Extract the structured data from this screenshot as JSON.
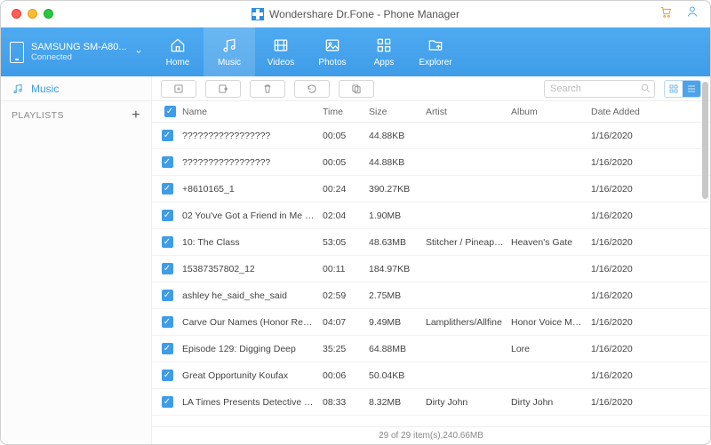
{
  "title": "Wondershare Dr.Fone - Phone Manager",
  "device": {
    "name": "SAMSUNG SM-A80...",
    "status": "Connected"
  },
  "nav": [
    {
      "key": "home",
      "label": "Home"
    },
    {
      "key": "music",
      "label": "Music"
    },
    {
      "key": "videos",
      "label": "Videos"
    },
    {
      "key": "photos",
      "label": "Photos"
    },
    {
      "key": "apps",
      "label": "Apps"
    },
    {
      "key": "explorer",
      "label": "Explorer"
    }
  ],
  "nav_active": "music",
  "sidebar": {
    "heading": "Music",
    "section": "PLAYLISTS"
  },
  "search_placeholder": "Search",
  "columns": {
    "name": "Name",
    "time": "Time",
    "size": "Size",
    "artist": "Artist",
    "album": "Album",
    "date": "Date Added"
  },
  "rows": [
    {
      "name": "?????????????????",
      "time": "00:05",
      "size": "44.88KB",
      "artist": "",
      "album": "",
      "date": "1/16/2020"
    },
    {
      "name": "?????????????????",
      "time": "00:05",
      "size": "44.88KB",
      "artist": "",
      "album": "",
      "date": "1/16/2020"
    },
    {
      "name": "+8610165_1",
      "time": "00:24",
      "size": "390.27KB",
      "artist": "",
      "album": "",
      "date": "1/16/2020"
    },
    {
      "name": "02 You've Got a Friend in Me (From...",
      "time": "02:04",
      "size": "1.90MB",
      "artist": "",
      "album": "",
      "date": "1/16/2020"
    },
    {
      "name": "10: The Class",
      "time": "53:05",
      "size": "48.63MB",
      "artist": "Stitcher / Pineapple...",
      "album": "Heaven's Gate",
      "date": "1/16/2020"
    },
    {
      "name": "15387357802_12",
      "time": "00:11",
      "size": "184.97KB",
      "artist": "",
      "album": "",
      "date": "1/16/2020"
    },
    {
      "name": "ashley he_said_she_said",
      "time": "02:59",
      "size": "2.75MB",
      "artist": "",
      "album": "",
      "date": "1/16/2020"
    },
    {
      "name": "Carve Our Names (Honor Remixed)",
      "time": "04:07",
      "size": "9.49MB",
      "artist": "Lamplithers/Allfine",
      "album": "Honor Voice Maker",
      "date": "1/16/2020"
    },
    {
      "name": "Episode 129: Digging Deep",
      "time": "35:25",
      "size": "64.88MB",
      "artist": "",
      "album": "Lore",
      "date": "1/16/2020"
    },
    {
      "name": "Great Opportunity Koufax",
      "time": "00:06",
      "size": "50.04KB",
      "artist": "",
      "album": "",
      "date": "1/16/2020"
    },
    {
      "name": "LA Times Presents Detective Trapp...",
      "time": "08:33",
      "size": "8.32MB",
      "artist": "Dirty John",
      "album": "Dirty John",
      "date": "1/16/2020"
    }
  ],
  "status": "29 of 29 item(s),240.66MB"
}
